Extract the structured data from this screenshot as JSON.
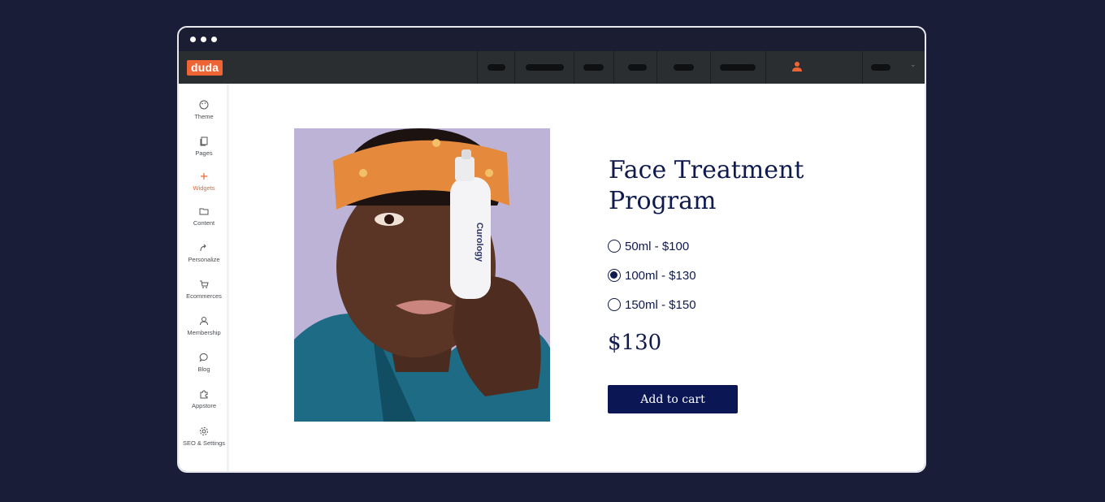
{
  "app": {
    "logo_text": "duda",
    "accent_color": "#ef6435"
  },
  "sidebar": {
    "items": [
      {
        "label": "Theme",
        "icon": "palette-icon"
      },
      {
        "label": "Pages",
        "icon": "pages-icon"
      },
      {
        "label": "Widgets",
        "icon": "plus-icon",
        "active": true
      },
      {
        "label": "Content",
        "icon": "folder-icon"
      },
      {
        "label": "Personalize",
        "icon": "personalize-icon"
      },
      {
        "label": "Ecommerces",
        "icon": "cart-icon"
      },
      {
        "label": "Membership",
        "icon": "user-icon"
      },
      {
        "label": "Blog",
        "icon": "chat-bubble-icon"
      },
      {
        "label": "Appstore",
        "icon": "puzzle-icon"
      },
      {
        "label": "SEO & Settings",
        "icon": "gear-icon"
      }
    ]
  },
  "product": {
    "title": "Face Treatment Program",
    "options": [
      {
        "label": "50ml - $100",
        "selected": false
      },
      {
        "label": "100ml - $130",
        "selected": true
      },
      {
        "label": "150ml - $150",
        "selected": false
      }
    ],
    "price": "$130",
    "add_to_cart_label": "Add to cart",
    "bottle_brand": "Curology"
  }
}
